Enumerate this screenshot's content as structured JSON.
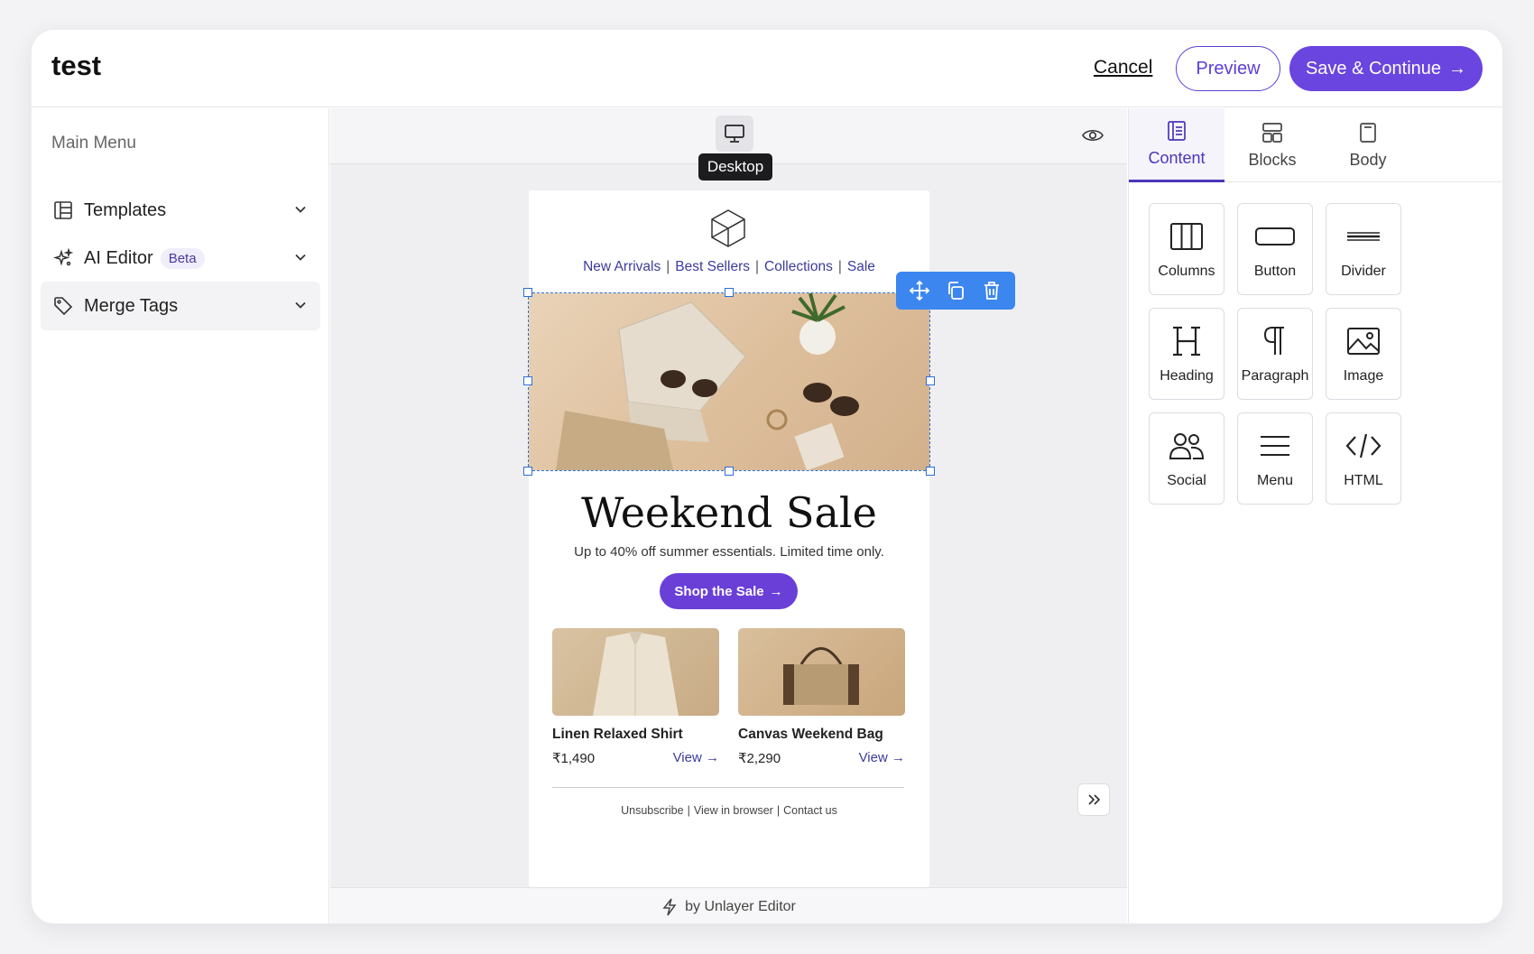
{
  "header": {
    "title": "test",
    "cancel_label": "Cancel",
    "preview_label": "Preview",
    "save_label": "Save & Continue",
    "save_arrow": "→"
  },
  "sidebar": {
    "heading": "Main Menu",
    "items": [
      {
        "label": "Templates",
        "icon": "template-icon"
      },
      {
        "label": "AI Editor",
        "badge": "Beta",
        "icon": "sparkle-icon"
      },
      {
        "label": "Merge Tags",
        "icon": "tag-icon"
      }
    ]
  },
  "canvas": {
    "device_tooltip": "Desktop",
    "footer_text": "by Unlayer Editor"
  },
  "email": {
    "nav": [
      "New Arrivals",
      "Best Sellers",
      "Collections",
      "Sale"
    ],
    "nav_separator": "|",
    "headline": "Weekend Sale",
    "subtitle": "Up to 40% off summer essentials. Limited time only.",
    "cta_label": "Shop the Sale",
    "cta_arrow": "→",
    "products": [
      {
        "name": "Linen Relaxed Shirt",
        "price": "₹1,490",
        "view": "View →"
      },
      {
        "name": "Canvas Weekend Bag",
        "price": "₹2,290",
        "view": "View →"
      }
    ],
    "footer_links": [
      "Unsubscribe",
      "View in browser",
      "Contact us"
    ]
  },
  "right_panel": {
    "tabs": [
      {
        "label": "Content",
        "icon": "content-icon",
        "active": true
      },
      {
        "label": "Blocks",
        "icon": "blocks-icon",
        "active": false
      },
      {
        "label": "Body",
        "icon": "body-icon",
        "active": false
      }
    ],
    "tools": [
      {
        "label": "Columns",
        "icon": "columns-icon"
      },
      {
        "label": "Button",
        "icon": "button-icon"
      },
      {
        "label": "Divider",
        "icon": "divider-icon"
      },
      {
        "label": "Heading",
        "icon": "heading-icon"
      },
      {
        "label": "Paragraph",
        "icon": "paragraph-icon"
      },
      {
        "label": "Image",
        "icon": "image-icon"
      },
      {
        "label": "Social",
        "icon": "social-icon"
      },
      {
        "label": "Menu",
        "icon": "menu-icon"
      },
      {
        "label": "HTML",
        "icon": "html-icon"
      }
    ]
  },
  "colors": {
    "accent": "#6a45e0",
    "selection": "#2a6fd9",
    "toolbar": "#3c86ef"
  }
}
